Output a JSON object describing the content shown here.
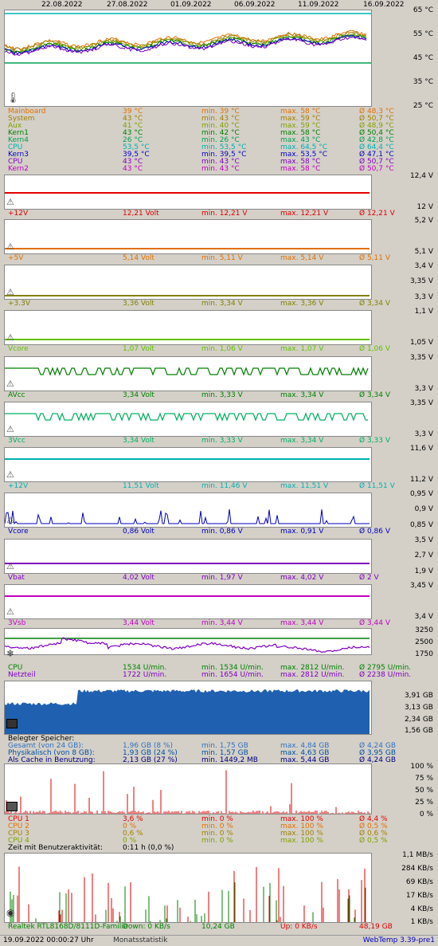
{
  "dates": [
    "22.08.2022",
    "27.08.2022",
    "01.09.2022",
    "06.09.2022",
    "11.09.2022",
    "16.09.2022"
  ],
  "temp": {
    "scale": [
      "65 °C",
      "55 °C",
      "45 °C",
      "35 °C",
      "25 °C"
    ],
    "rows": [
      {
        "name": "Mainboard",
        "cur": "39 °C",
        "min": "min. 39 °C",
        "max": "max. 58 °C",
        "avg": "Ø 48,3 °C",
        "color": "#e07000"
      },
      {
        "name": "System",
        "cur": "43 °C",
        "min": "min. 43 °C",
        "max": "max. 59 °C",
        "avg": "Ø 50,7 °C",
        "color": "#a08000"
      },
      {
        "name": "Aux",
        "cur": "41 °C",
        "min": "min. 40 °C",
        "max": "max. 59 °C",
        "avg": "Ø 48,9 °C",
        "color": "#80a000"
      },
      {
        "name": "Kern1",
        "cur": "43 °C",
        "min": "min. 42 °C",
        "max": "max. 58 °C",
        "avg": "Ø 50,4 °C",
        "color": "#008000"
      },
      {
        "name": "Kern4",
        "cur": "26 °C",
        "min": "min. 26 °C",
        "max": "max. 43 °C",
        "avg": "Ø 42,8 °C",
        "color": "#00a050"
      },
      {
        "name": "CPU",
        "cur": "53,5 °C",
        "min": "min. 53,5 °C",
        "max": "max. 64,5 °C",
        "avg": "Ø 64,4 °C",
        "color": "#00b0b0"
      },
      {
        "name": "Kern3",
        "cur": "39,5 °C",
        "min": "min. 39,5 °C",
        "max": "max. 53,5 °C",
        "avg": "Ø 47,1 °C",
        "color": "#0000c0"
      },
      {
        "name": "CPU",
        "cur": "43 °C",
        "min": "min. 43 °C",
        "max": "max. 58 °C",
        "avg": "Ø 50,7 °C",
        "color": "#8000c0"
      },
      {
        "name": "Kern2",
        "cur": "43 °C",
        "min": "min. 43 °C",
        "max": "max. 58 °C",
        "avg": "Ø 50,7 °C",
        "color": "#c000c0"
      }
    ]
  },
  "volts": [
    {
      "scale_top": "12,4 V",
      "scale_bot": "12 V",
      "name": "+12V",
      "cur": "12,21 Volt",
      "min": "min. 12,21 V",
      "max": "max. 12,21 V",
      "avg": "Ø 12,21 V",
      "color": "#e00000"
    },
    {
      "scale_top": "5,2 V",
      "scale_bot": "5,1 V",
      "name": "+5V",
      "cur": "5,14 Volt",
      "min": "min. 5,11 V",
      "max": "max. 5,14 V",
      "avg": "Ø 5,11 V",
      "color": "#e07000"
    },
    {
      "scale_top": "3,4 V",
      "scale_mid": "3,35 V",
      "scale_bot": "3,3 V",
      "name": "+3.3V",
      "cur": "3,36 Volt",
      "min": "min. 3,34 V",
      "max": "max. 3,36 V",
      "avg": "Ø 3,34 V",
      "color": "#808000"
    },
    {
      "scale_top": "1,1 V",
      "scale_bot": "1,05 V",
      "name": "Vcore",
      "cur": "1,07 Volt",
      "min": "min. 1,06 V",
      "max": "max. 1,07 V",
      "avg": "Ø 1,06 V",
      "color": "#60c000"
    },
    {
      "scale_top": "3,35 V",
      "scale_bot": "3,3 V",
      "name": "AVcc",
      "cur": "3,34 Volt",
      "min": "min. 3,33 V",
      "max": "max. 3,34 V",
      "avg": "Ø 3,34 V",
      "color": "#008000"
    },
    {
      "scale_top": "3,35 V",
      "scale_bot": "3,3 V",
      "name": "3Vcc",
      "cur": "3,34 Volt",
      "min": "min. 3,33 V",
      "max": "max. 3,34 V",
      "avg": "Ø 3,33 V",
      "color": "#00b060"
    },
    {
      "scale_top": "11,6 V",
      "scale_bot": "11,2 V",
      "name": "+12V",
      "cur": "11,51 Volt",
      "min": "min. 11,46 V",
      "max": "max. 11,51 V",
      "avg": "Ø 11,51 V",
      "color": "#00b0b0"
    },
    {
      "scale_top": "0,95 V",
      "scale_mid": "0,9 V",
      "scale_bot": "0,85 V",
      "name": "Vcore",
      "cur": "0,86 Volt",
      "min": "min. 0,86 V",
      "max": "max. 0,91 V",
      "avg": "Ø 0,86 V",
      "color": "#0000c0"
    },
    {
      "scale_top": "3,5 V",
      "scale_mid": "2,7 V",
      "scale_bot": "1,9 V",
      "name": "Vbat",
      "cur": "4,02 Volt",
      "min": "min. 1,97 V",
      "max": "max. 4,02 V",
      "avg": "Ø 2 V",
      "color": "#8000c0"
    },
    {
      "scale_top": "3,45 V",
      "scale_bot": "3,4 V",
      "name": "3Vsb",
      "cur": "3,44 Volt",
      "min": "min. 3,44 V",
      "max": "max. 3,44 V",
      "avg": "Ø 3,44 V",
      "color": "#c000c0"
    }
  ],
  "fans": {
    "scale": [
      "3250",
      "2500",
      "1750"
    ],
    "rows": [
      {
        "name": "CPU",
        "cur": "1534 U/min.",
        "min": "min. 1534 U/min.",
        "max": "max. 2812 U/min.",
        "avg": "Ø 2795 U/min.",
        "color": "#008000"
      },
      {
        "name": "Netzteil",
        "cur": "1722 U/min.",
        "min": "min. 1654 U/min.",
        "max": "max. 2812 U/min.",
        "avg": "Ø 2238 U/min.",
        "color": "#8000c0"
      }
    ]
  },
  "mem": {
    "scale": [
      "3,91 GB",
      "3,13 GB",
      "2,34 GB",
      "1,56 GB"
    ],
    "title": "Belegter Speicher:",
    "rows": [
      {
        "name": "Gesamt (von 24 GB):",
        "cur": "1,96 GB (8 %)",
        "min": "min. 1,75 GB",
        "max": "max. 4,84 GB",
        "avg": "Ø 4,24 GB",
        "color": "#3070c0"
      },
      {
        "name": "Physikalisch (von 8 GB):",
        "cur": "1,93 GB (24 %)",
        "min": "min. 1,57 GB",
        "max": "max. 4,63 GB",
        "avg": "Ø 3,95 GB",
        "color": "#0050a0"
      },
      {
        "name": "Als Cache in Benutzung:",
        "cur": "2,13 GB (27 %)",
        "min": "min. 1449,2 MB",
        "max": "max. 5,44 GB",
        "avg": "Ø 4,24 GB",
        "color": "#000080"
      }
    ]
  },
  "cpu": {
    "scale": [
      "100 %",
      "75 %",
      "50 %",
      "25 %",
      "0 %"
    ],
    "rows": [
      {
        "name": "CPU 1",
        "cur": "3,6 %",
        "min": "min. 0 %",
        "max": "max. 100 %",
        "avg": "Ø 4,4 %",
        "color": "#e00000"
      },
      {
        "name": "CPU 2",
        "cur": "0 %",
        "min": "min. 0 %",
        "max": "max. 100 %",
        "avg": "Ø 0,5 %",
        "color": "#e07000"
      },
      {
        "name": "CPU 3",
        "cur": "0,6 %",
        "min": "min. 0 %",
        "max": "max. 100 %",
        "avg": "Ø 0,6 %",
        "color": "#a08000"
      },
      {
        "name": "CPU 4",
        "cur": "0 %",
        "min": "min. 0 %",
        "max": "max. 100 %",
        "avg": "Ø 0,5 %",
        "color": "#80a000"
      }
    ],
    "activity_label": "Zeit mit Benutzeraktivität:",
    "activity_value": "0:11 h (0,0 %)"
  },
  "net": {
    "scale": [
      "1,1 MB/s",
      "284 KB/s",
      "69 KB/s",
      "17 KB/s",
      "4 KB/s",
      "1 KB/s"
    ],
    "name": "Realtek RTL8168D/8111D-Familie",
    "down": "Down: 0 KB/s",
    "down_total": "10,24 GB",
    "up": "Up: 0 KB/s",
    "up_total": "48,19 GB"
  },
  "footer": {
    "datetime": "19.09.2022 00:00:27 Uhr",
    "link": "Monatsstatistik",
    "version": "WebTemp 3.39-pre1"
  }
}
